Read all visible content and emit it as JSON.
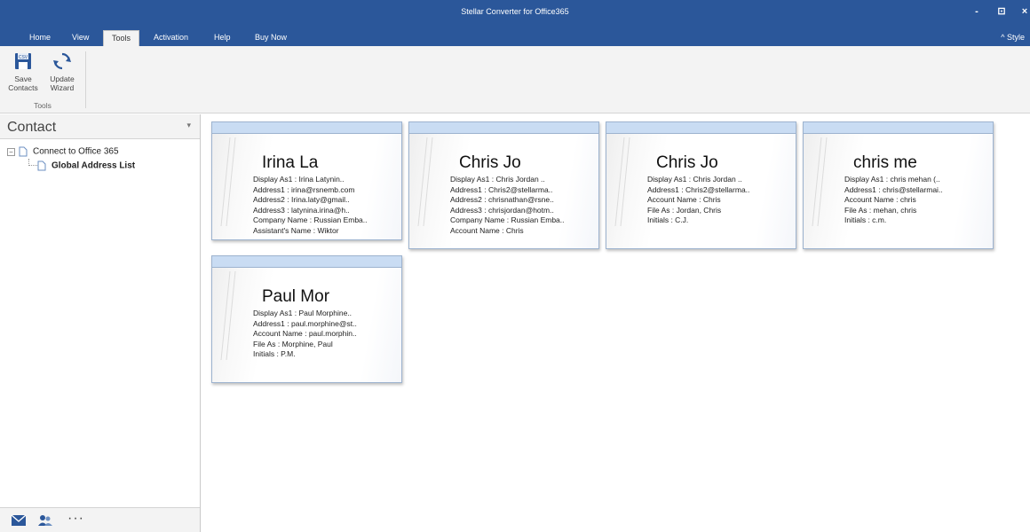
{
  "window": {
    "title": "Stellar Converter for Office365",
    "controls": [
      "-",
      "⊡",
      "×"
    ]
  },
  "ribbon": {
    "tabs": [
      "Home",
      "View",
      "Tools",
      "Activation",
      "Help",
      "Buy Now"
    ],
    "active_tab": "Tools",
    "style_label": "^ Style",
    "buttons": [
      {
        "label1": "Save",
        "label2": "Contacts",
        "icon": "save-contacts-csv-icon"
      },
      {
        "label1": "Update",
        "label2": "Wizard",
        "icon": "update-wizard-icon"
      }
    ],
    "group_label": "Tools"
  },
  "left_pane": {
    "title": "Contact",
    "pin": "▾",
    "tree": {
      "root": "Connect to Office 365",
      "child": "Global Address List"
    },
    "bottom_more": "···"
  },
  "cards": [
    {
      "name": "Irina La",
      "lines": [
        "Display As1 : Irina Latynin..",
        "Address1 : irina@rsnemb.com",
        "Address2 : Irina.laty@gmail..",
        "Address3 : latynina.irina@h..",
        "Company Name : Russian Emba..",
        "Assistant's Name : Wiktor"
      ]
    },
    {
      "name": "Chris Jo",
      "lines": [
        "Display As1 : Chris Jordan ..",
        "Address1 : Chris2@stellarma..",
        "Address2 : chrisnathan@rsne..",
        "Address3 : chrisjordan@hotm..",
        "Company Name : Russian Emba..",
        "Account Name : Chris"
      ]
    },
    {
      "name": "Chris Jo",
      "lines": [
        "Display As1 : Chris Jordan ..",
        "Address1 : Chris2@stellarma..",
        "Account Name : Chris",
        "File As : Jordan, Chris",
        "Initials : C.J."
      ]
    },
    {
      "name": "chris me",
      "lines": [
        "Display As1 : chris mehan (..",
        "Address1 : chris@stellarmai..",
        "Account Name : chris",
        "File As : mehan, chris",
        "Initials : c.m."
      ]
    },
    {
      "name": "Paul Mor",
      "lines": [
        "Display As1 : Paul Morphine..",
        "Address1 : paul.morphine@st..",
        "Account Name : paul.morphin..",
        "File As : Morphine, Paul",
        "Initials : P.M."
      ]
    }
  ]
}
